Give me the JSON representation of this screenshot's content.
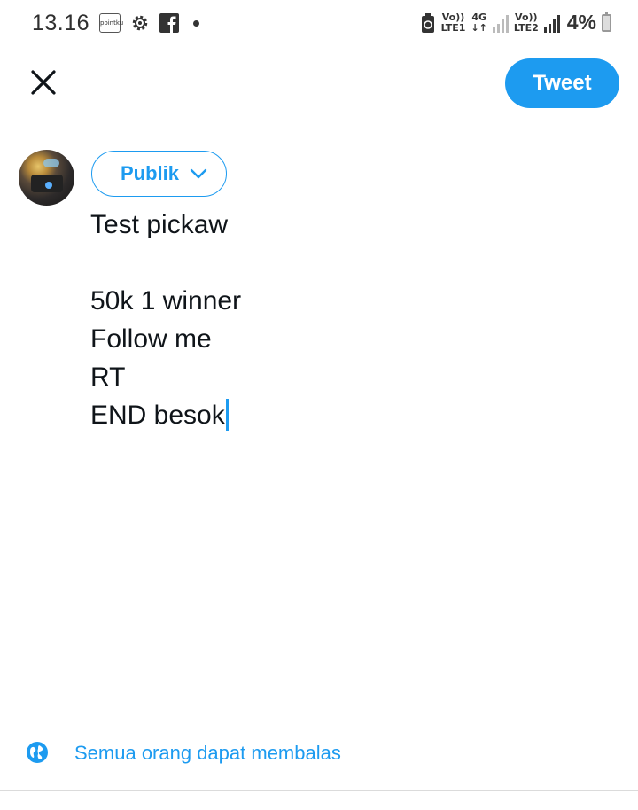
{
  "status_bar": {
    "time": "13.16",
    "pointku_label": "pointku",
    "sim1_label_top": "Vo))",
    "sim1_label_bottom": "LTE1",
    "net_type": "4G",
    "net_arrows": "↓↑",
    "sim2_label_top": "Vo))",
    "sim2_label_bottom": "LTE2",
    "battery_percent": "4%"
  },
  "header": {
    "tweet_button_label": "Tweet"
  },
  "composer": {
    "audience_label": "Publik",
    "lines": [
      "Test pickaw",
      "",
      "50k 1 winner",
      "Follow me",
      "RT",
      "END besok"
    ]
  },
  "reply_setting": {
    "label": "Semua orang dapat membalas"
  },
  "colors": {
    "accent": "#1d9bf0",
    "text": "#0f1419",
    "divider": "#dbdbdb"
  },
  "icons": [
    "settings-icon",
    "facebook-icon",
    "battery-saver-icon",
    "close-icon",
    "chevron-down-icon",
    "globe-icon"
  ]
}
